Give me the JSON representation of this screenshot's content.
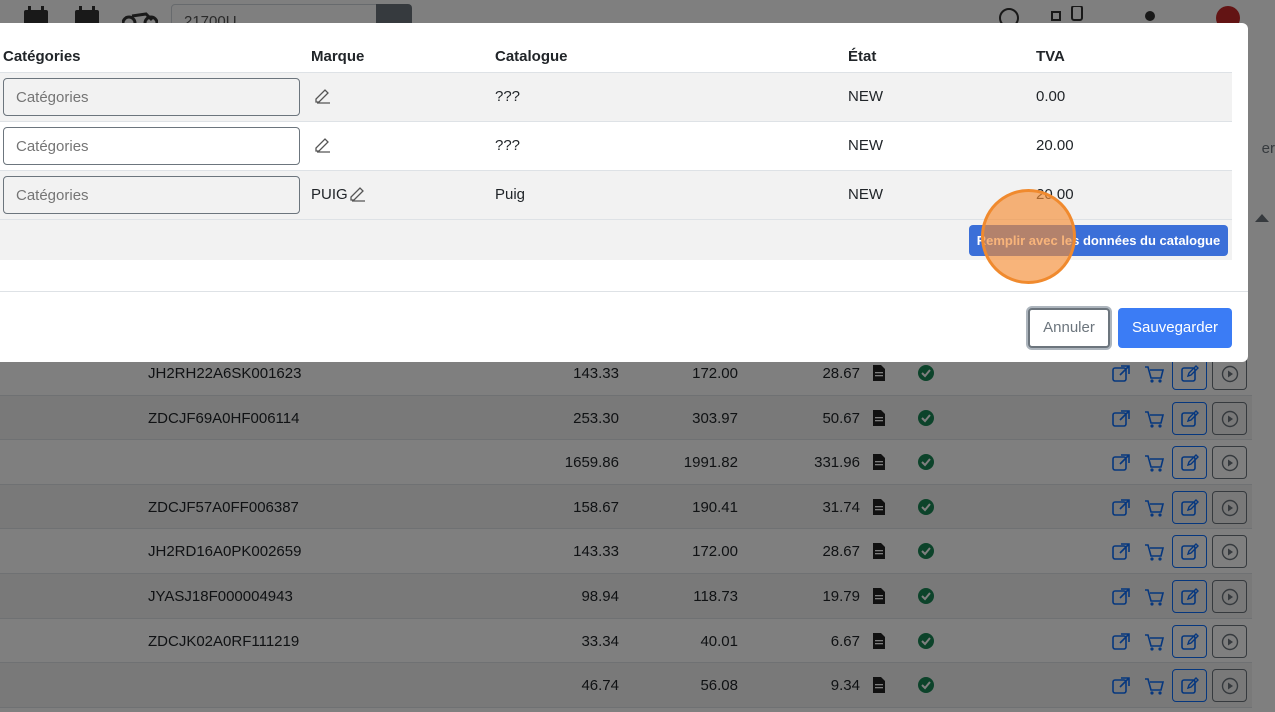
{
  "topbar": {
    "search_value": "21700U"
  },
  "side": {
    "hint": "er"
  },
  "bg_rows": [
    {
      "vin": "JH2RH22A6SK001623",
      "ht": "143.33",
      "ttc": "172.00",
      "tva": "28.67"
    },
    {
      "vin": "ZDCJF69A0HF006114",
      "ht": "253.30",
      "ttc": "303.97",
      "tva": "50.67"
    },
    {
      "vin": "",
      "ht": "1659.86",
      "ttc": "1991.82",
      "tva": "331.96"
    },
    {
      "vin": "ZDCJF57A0FF006387",
      "ht": "158.67",
      "ttc": "190.41",
      "tva": "31.74"
    },
    {
      "vin": "JH2RD16A0PK002659",
      "ht": "143.33",
      "ttc": "172.00",
      "tva": "28.67"
    },
    {
      "vin": "JYASJ18F000004943",
      "ht": "98.94",
      "ttc": "118.73",
      "tva": "19.79"
    },
    {
      "vin": "ZDCJK02A0RF111219",
      "ht": "33.34",
      "ttc": "40.01",
      "tva": "6.67"
    },
    {
      "vin": "",
      "ht": "46.74",
      "ttc": "56.08",
      "tva": "9.34"
    }
  ],
  "modal": {
    "headers": {
      "categories": "Catégories",
      "marque": "Marque",
      "catalogue": "Catalogue",
      "etat": "État",
      "tva": "TVA"
    },
    "rows": [
      {
        "categories_placeholder": "Catégories",
        "marque": "",
        "catalogue": "???",
        "etat": "NEW",
        "tva": "0.00"
      },
      {
        "categories_placeholder": "Catégories",
        "marque": "",
        "catalogue": "???",
        "etat": "NEW",
        "tva": "20.00"
      },
      {
        "categories_placeholder": "Catégories",
        "marque": "PUIG",
        "catalogue": "Puig",
        "etat": "NEW",
        "tva": "20.00"
      }
    ],
    "fill_button": "Remplir avec les données du catalogue",
    "cancel_button": "Annuler",
    "save_button": "Sauvegarder"
  },
  "colors": {
    "primary": "#3b7cf5",
    "success": "#198754",
    "cursor": "#f08a2e"
  }
}
